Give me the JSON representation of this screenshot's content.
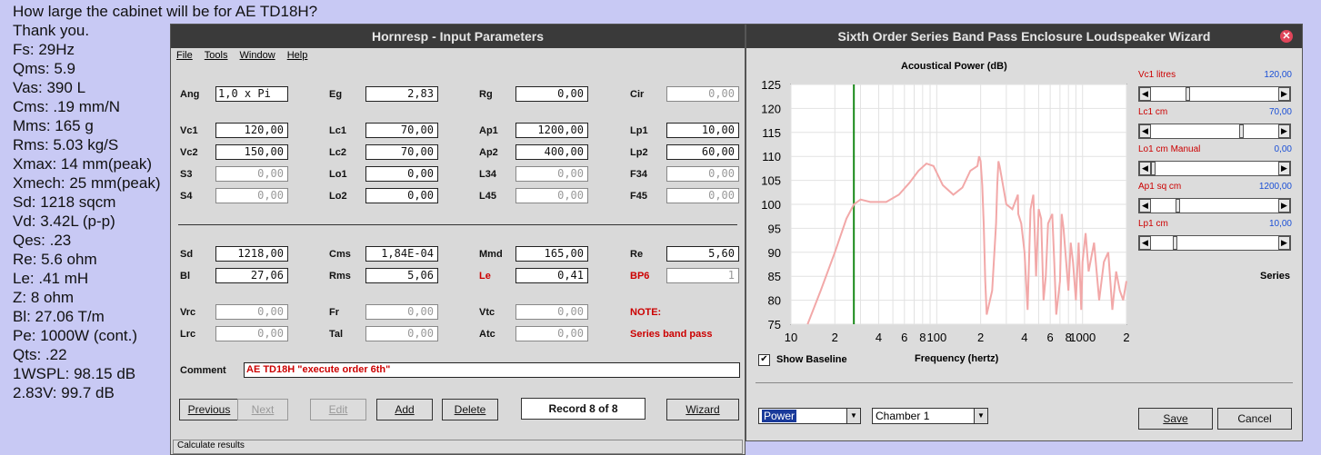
{
  "background_text": [
    "How large the cabinet will be for AE TD18H?",
    "Thank you.",
    "Fs: 29Hz",
    "Qms: 5.9",
    "Vas: 390 L",
    "Cms: .19 mm/N",
    "Mms: 165 g",
    "Rms: 5.03 kg/S",
    "Xmax: 14 mm(peak)",
    "Xmech: 25 mm(peak)",
    "Sd: 1218 sqcm",
    "Vd: 3.42L (p-p)",
    "Qes: .23",
    "Re: 5.6 ohm",
    "Le: .41 mH",
    "Z: 8 ohm",
    "Bl: 27.06 T/m",
    "Pe: 1000W (cont.)",
    "Qts: .22",
    "1WSPL: 98.15 dB",
    "2.83V: 99.7 dB"
  ],
  "input_window": {
    "title": "Hornresp - Input Parameters",
    "menu": [
      "File",
      "Tools",
      "Window",
      "Help"
    ],
    "rows": [
      [
        {
          "l": "Ang",
          "v": "1,0 x Pi"
        },
        {
          "l": "Eg",
          "v": "2,83"
        },
        {
          "l": "Rg",
          "v": "0,00"
        },
        {
          "l": "Cir",
          "v": "0,00"
        }
      ],
      [
        {
          "l": "Vc1",
          "v": "120,00"
        },
        {
          "l": "Lc1",
          "v": "70,00"
        },
        {
          "l": "Ap1",
          "v": "1200,00"
        },
        {
          "l": "Lp1",
          "v": "10,00"
        }
      ],
      [
        {
          "l": "Vc2",
          "v": "150,00"
        },
        {
          "l": "Lc2",
          "v": "70,00"
        },
        {
          "l": "Ap2",
          "v": "400,00"
        },
        {
          "l": "Lp2",
          "v": "60,00"
        }
      ],
      [
        {
          "l": "S3",
          "v": "0,00"
        },
        {
          "l": "Lo1",
          "v": "0,00"
        },
        {
          "l": "L34",
          "v": "0,00"
        },
        {
          "l": "F34",
          "v": "0,00"
        }
      ],
      [
        {
          "l": "S4",
          "v": "0,00"
        },
        {
          "l": "Lo2",
          "v": "0,00"
        },
        {
          "l": "L45",
          "v": "0,00"
        },
        {
          "l": "F45",
          "v": "0,00"
        }
      ],
      [
        {
          "l": "Sd",
          "v": "1218,00"
        },
        {
          "l": "Cms",
          "v": "1,84E-04"
        },
        {
          "l": "Mmd",
          "v": "165,00"
        },
        {
          "l": "Re",
          "v": "5,60"
        }
      ],
      [
        {
          "l": "Bl",
          "v": "27,06"
        },
        {
          "l": "Rms",
          "v": "5,06"
        },
        {
          "l": "Le",
          "v": "0,41"
        },
        {
          "l": "BP6",
          "v": "1"
        }
      ],
      [
        {
          "l": "Vrc",
          "v": "0,00"
        },
        {
          "l": "Fr",
          "v": "0,00"
        },
        {
          "l": "Vtc",
          "v": "0,00"
        },
        {
          "l": "NOTE:",
          "v": ""
        }
      ],
      [
        {
          "l": "Lrc",
          "v": "0,00"
        },
        {
          "l": "Tal",
          "v": "0,00"
        },
        {
          "l": "Atc",
          "v": "0,00"
        },
        {
          "l": "Series band pass",
          "v": ""
        }
      ]
    ],
    "comment_label": "Comment",
    "comment_value": "AE TD18H \"execute order 6th\"",
    "buttons": {
      "previous": "Previous",
      "next": "Next",
      "edit": "Edit",
      "add": "Add",
      "delete": "Delete",
      "record": "Record 8 of 8",
      "wizard": "Wizard"
    },
    "status": "Calculate results"
  },
  "wizard_window": {
    "title": "Sixth Order Series Band Pass Enclosure Loudspeaker Wizard",
    "close_icon": "close-icon",
    "sliders": [
      {
        "label": "Vc1  litres",
        "value": "120,00",
        "pos": 0.28
      },
      {
        "label": "Lc1  cm",
        "value": "70,00",
        "pos": 0.72
      },
      {
        "label": "Lo1  cm  Manual",
        "value": "0,00",
        "pos": 0.0
      },
      {
        "label": "Ap1  sq cm",
        "value": "1200,00",
        "pos": 0.2
      },
      {
        "label": "Lp1  cm",
        "value": "10,00",
        "pos": 0.18
      }
    ],
    "series_label": "Series",
    "show_baseline": "Show Baseline",
    "combo_power": "Power",
    "combo_chamber": "Chamber 1",
    "save": "Save",
    "cancel": "Cancel"
  },
  "chart_data": {
    "type": "line",
    "title": "Acoustical Power (dB)",
    "xlabel": "Frequency (hertz)",
    "ylabel": "",
    "x_scale": "log",
    "xlim": [
      10,
      2000
    ],
    "ylim": [
      75,
      125
    ],
    "yticks": [
      125,
      120,
      115,
      110,
      105,
      100,
      95,
      90,
      85,
      80,
      75
    ],
    "xtick_labels": [
      "10",
      "2",
      "4",
      "6",
      "8",
      "100",
      "2",
      "4",
      "6",
      "8",
      "1000",
      "2"
    ],
    "xtick_values": [
      10,
      20,
      40,
      60,
      80,
      100,
      200,
      400,
      600,
      800,
      1000,
      2000
    ],
    "marker_line_x": 27,
    "series": [
      {
        "color": "#f2a8a8",
        "x": [
          13,
          16,
          20,
          24,
          27,
          30,
          35,
          45,
          55,
          65,
          75,
          85,
          95,
          110,
          130,
          150,
          170,
          190,
          195,
          200,
          205,
          210,
          215,
          220,
          240,
          255,
          260,
          265,
          270,
          300,
          330,
          360,
          362,
          380,
          400,
          420,
          440,
          460,
          470,
          480,
          500,
          520,
          540,
          560,
          580,
          620,
          640,
          660,
          700,
          720,
          740,
          800,
          830,
          860,
          900,
          940,
          980,
          1000,
          1050,
          1100,
          1200,
          1300,
          1400,
          1500,
          1600,
          1700,
          1800,
          1900,
          2000
        ],
        "y": [
          75,
          82,
          90,
          97,
          100,
          101,
          100.5,
          100.5,
          102,
          104.5,
          107,
          108.5,
          108,
          104,
          102,
          103.5,
          107,
          108,
          110,
          109,
          104,
          96,
          84,
          77,
          82,
          96,
          104,
          109,
          108,
          100,
          99,
          102,
          98,
          96,
          90,
          78,
          99,
          102,
          94,
          85,
          99,
          97,
          80,
          85,
          96,
          98,
          88,
          77,
          84,
          98,
          95,
          82,
          92,
          88,
          80,
          92,
          78,
          88,
          94,
          86,
          92,
          80,
          88,
          90,
          78,
          86,
          82,
          80,
          84
        ]
      }
    ]
  }
}
